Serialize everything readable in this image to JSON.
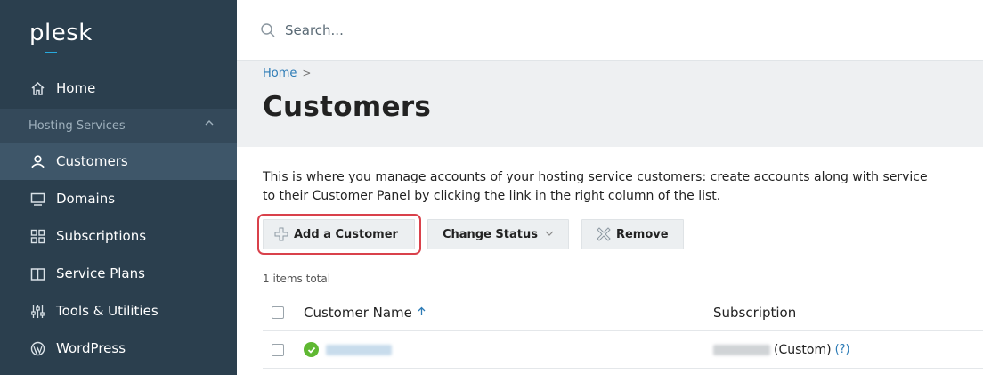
{
  "brand": {
    "logo": "plesk"
  },
  "search": {
    "placeholder": "Search..."
  },
  "sidebar": {
    "home": "Home",
    "group_label": "Hosting Services",
    "items": [
      {
        "label": "Customers",
        "icon": "user-icon",
        "active": true
      },
      {
        "label": "Domains",
        "icon": "monitor-icon"
      },
      {
        "label": "Subscriptions",
        "icon": "grid-icon"
      },
      {
        "label": "Service Plans",
        "icon": "book-icon"
      },
      {
        "label": "Tools & Utilities",
        "icon": "sliders-icon"
      },
      {
        "label": "WordPress",
        "icon": "wordpress-icon"
      }
    ]
  },
  "breadcrumb": {
    "home": "Home",
    "separator": ">"
  },
  "page": {
    "title": "Customers",
    "description_line1": "This is where you manage accounts of your hosting service customers: create accounts along with service",
    "description_line2": "to their Customer Panel by clicking the link in the right column of the list."
  },
  "toolbar": {
    "add_label": "Add a Customer",
    "change_status_label": "Change Status",
    "remove_label": "Remove"
  },
  "list": {
    "items_total": "1 items total",
    "columns": {
      "name": "Customer Name",
      "subscription": "Subscription"
    },
    "rows": [
      {
        "status": "active",
        "subscription_suffix": "(Custom)",
        "help": "(?)"
      }
    ]
  },
  "colors": {
    "sidebar_bg": "#2b3f4e",
    "active_bg": "#3e5669",
    "link": "#2c7bb6",
    "highlight": "#d9414b",
    "status_ok": "#5fb832"
  }
}
